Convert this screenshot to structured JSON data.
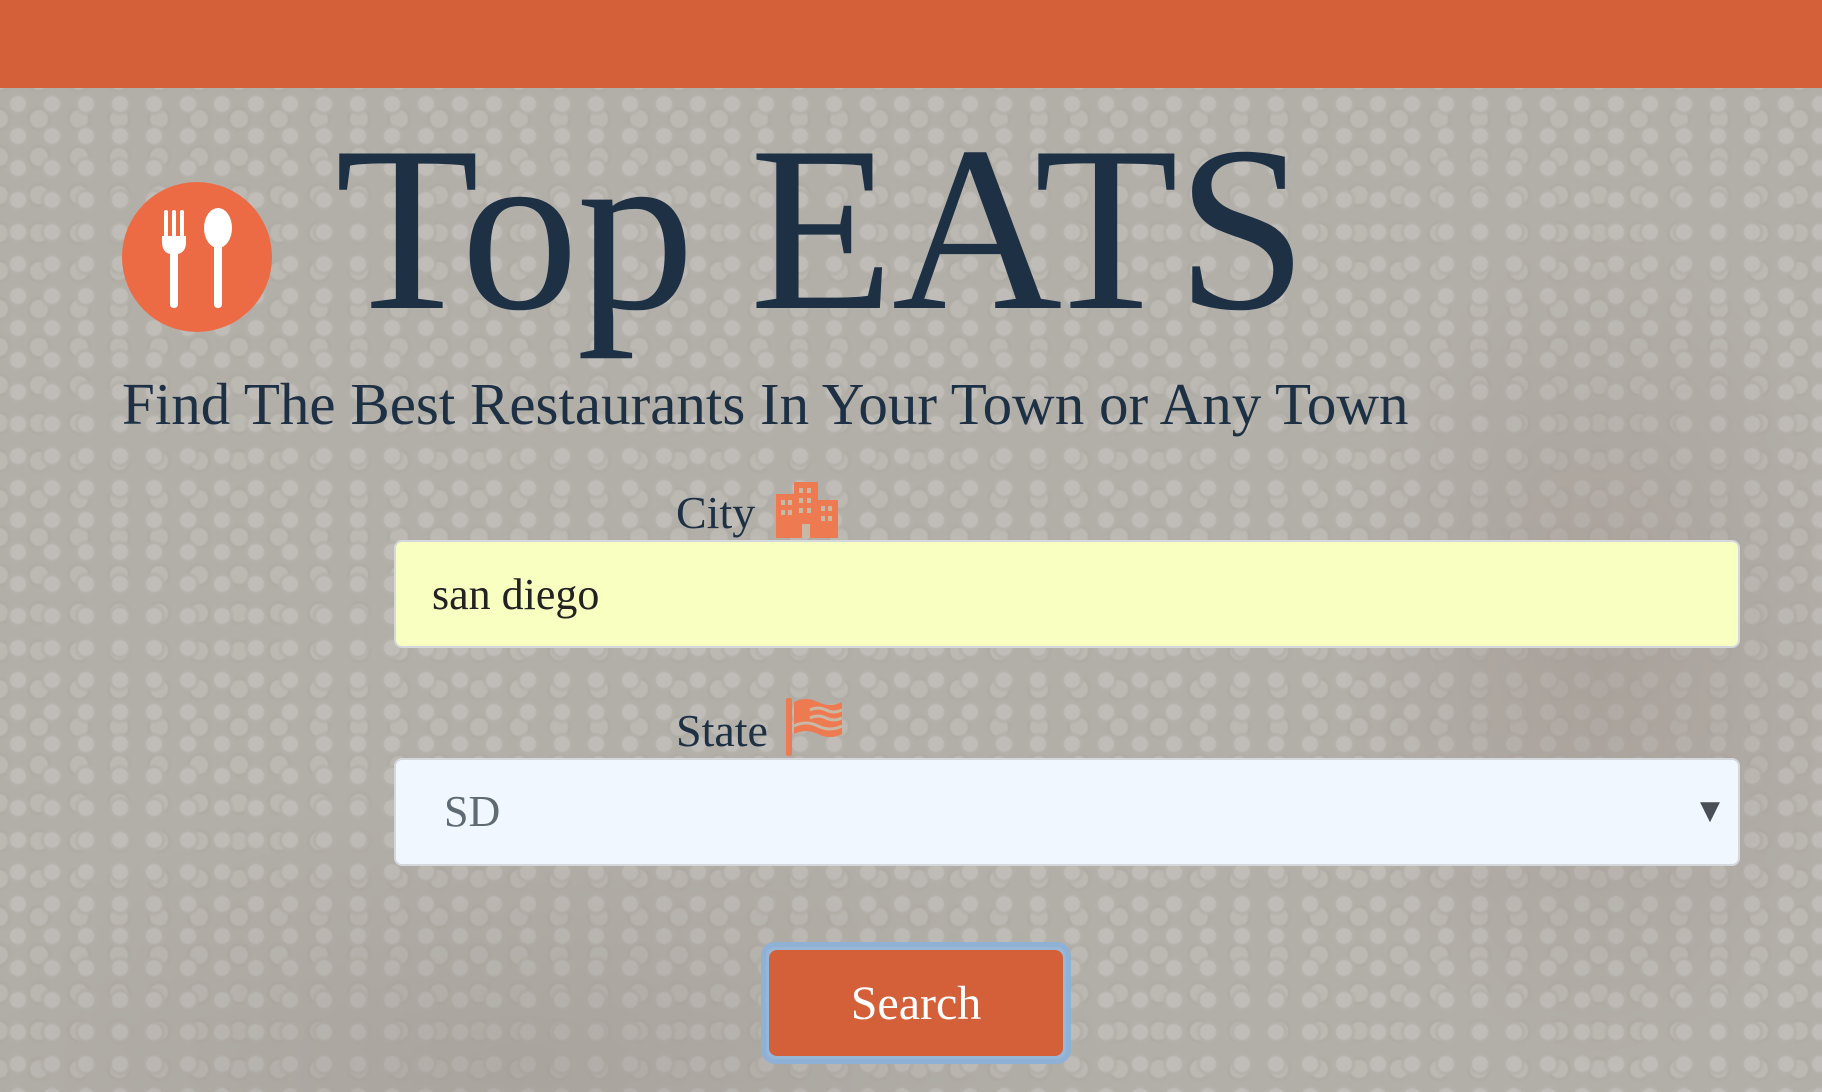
{
  "header": {
    "title": "Top EATS",
    "subtitle": "Find The Best Restaurants In Your Town or Any Town",
    "logo_icon": "utensils-icon"
  },
  "form": {
    "city_label": "City",
    "city_icon": "city-buildings-icon",
    "city_value": "san diego",
    "state_label": "State",
    "state_icon": "us-flag-icon",
    "state_value": "SD",
    "search_label": "Search"
  },
  "colors": {
    "brand": "#d4603a",
    "logo": "#ed6b44",
    "title_text": "#1d3044",
    "city_field_bg": "#f8ffc1",
    "state_field_bg": "#f0f7ff"
  }
}
